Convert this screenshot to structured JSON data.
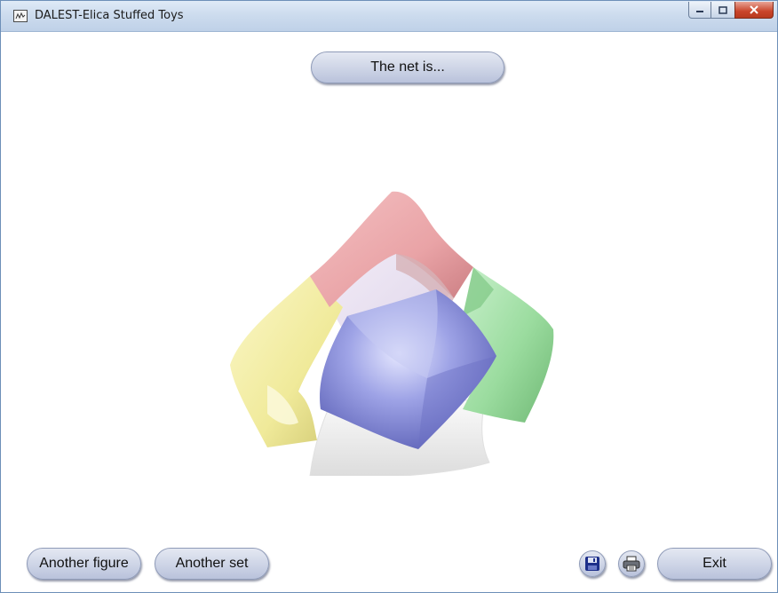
{
  "window": {
    "title": "DALEST-Elica Stuffed Toys"
  },
  "header": {
    "prompt_button_label": "The net is..."
  },
  "viewer": {
    "faces": {
      "top": "#e9a3a6",
      "left": "#f0ea9a",
      "right": "#9bdc9f",
      "bottom": "#f2f2f2",
      "center": "#9ea3e6"
    }
  },
  "footer": {
    "another_figure_label": "Another figure",
    "another_set_label": "Another set",
    "save_icon": "floppy-disk-icon",
    "print_icon": "printer-icon",
    "exit_label": "Exit"
  }
}
